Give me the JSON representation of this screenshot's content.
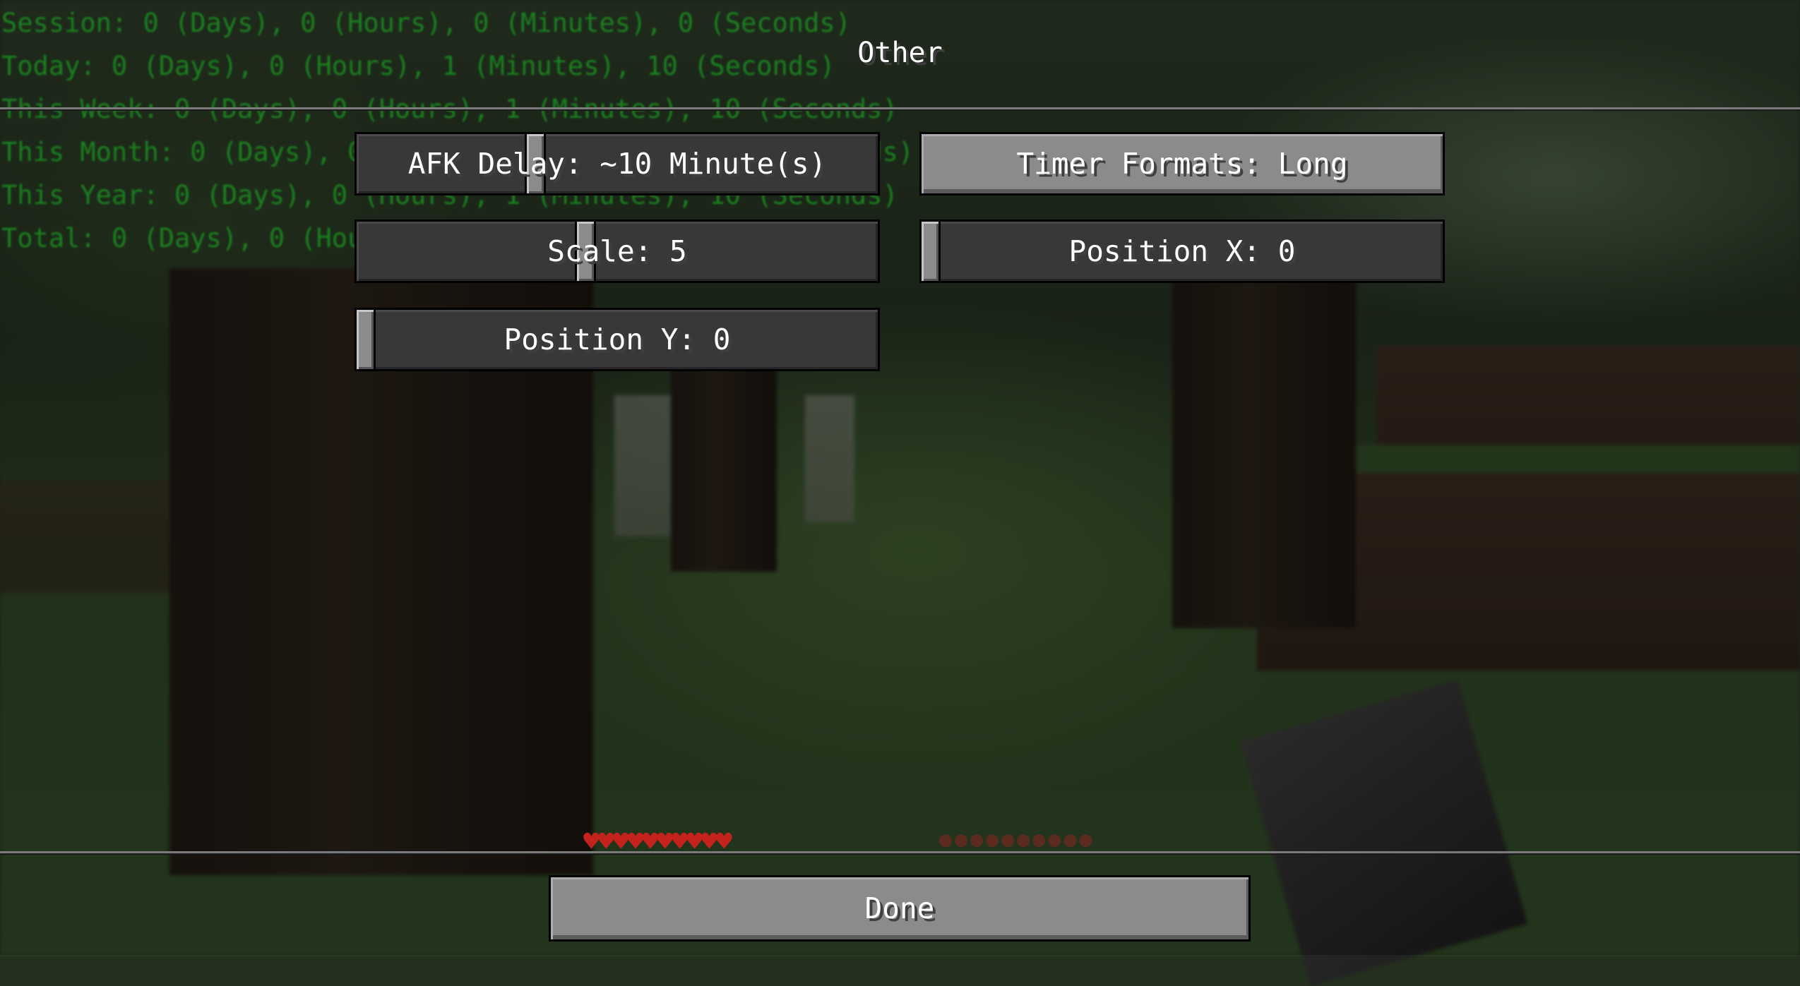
{
  "hud": {
    "playtime_lines": [
      "Session: 0 (Days), 0 (Hours), 0 (Minutes), 0 (Seconds)",
      "Today: 0 (Days), 0 (Hours), 1 (Minutes), 10 (Seconds)",
      "This Week: 0 (Days), 0 (Hours), 1 (Minutes), 10 (Seconds)",
      "This Month: 0 (Days), 0 (Hours), 1 (Minutes), 10 (Seconds)",
      "This Year: 0 (Days), 0 (Hours), 1 (Minutes), 10 (Seconds)",
      "Total: 0 (Days), 0 (Hours), 1 (Minutes), 10 (Seconds)"
    ],
    "hearts": "♥♥♥♥♥♥♥♥♥♥",
    "hunger": "●●●●●●●●●●",
    "text_color": "#1a9e22",
    "heart_color": "#c4221d"
  },
  "screen": {
    "title": "Other",
    "controls": {
      "afk_delay": {
        "label": "AFK Delay: ~10 Minute(s)",
        "slider_fraction": 0.34
      },
      "timer_formats": {
        "label": "Timer Formats: Long"
      },
      "scale": {
        "label": "Scale: 5",
        "slider_fraction": 0.44
      },
      "position_x": {
        "label": "Position X: 0",
        "slider_fraction": 0.0
      },
      "position_y": {
        "label": "Position Y: 0",
        "slider_fraction": 0.0
      }
    },
    "done": {
      "label": "Done"
    }
  }
}
